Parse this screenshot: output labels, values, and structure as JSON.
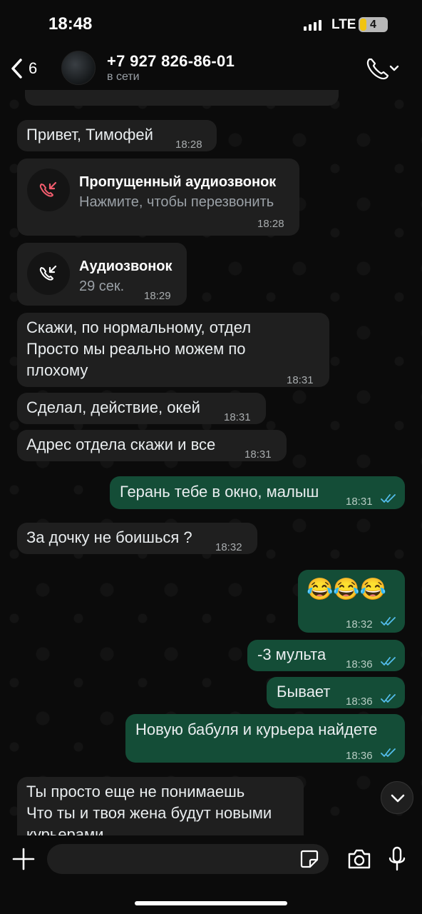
{
  "status_bar": {
    "time": "18:48",
    "network": "LTE",
    "battery": "4"
  },
  "header": {
    "back_count": "6",
    "contact_name": "+7 927 826-86-01",
    "contact_status": "в сети"
  },
  "messages": [
    {
      "text": "Привет, Тимофей",
      "time": "18:28"
    },
    {
      "call_title": "Пропущенный аудиозвонок",
      "call_sub": "Нажмите, чтобы перезвонить",
      "time": "18:28"
    },
    {
      "call_title": "Аудиозвонок",
      "call_sub": "29 сек.",
      "time": "18:29"
    },
    {
      "text": "Скажи, по нормальному, отдел\nПросто мы реально можем по\nплохому",
      "time": "18:31"
    },
    {
      "text": "Сделал, действие, окей",
      "time": "18:31"
    },
    {
      "text": "Адрес отдела скажи и все",
      "time": "18:31"
    },
    {
      "text": "Герань тебе в окно, малыш",
      "time": "18:31"
    },
    {
      "text": "За дочку не боишься ?",
      "time": "18:32"
    },
    {
      "text": "😂😂😂",
      "time": "18:32"
    },
    {
      "text": "-3 мульта",
      "time": "18:36"
    },
    {
      "text": "Бывает",
      "time": "18:36"
    },
    {
      "text": "Новую бабуля и курьера найдете",
      "time": "18:36"
    },
    {
      "text": "Ты просто еще не понимаешь\nЧто ты и твоя жена будут новыми\nкурьерами"
    }
  ],
  "input": {
    "placeholder": ""
  },
  "colors": {
    "incoming": "#1f1f1f",
    "outgoing": "#144d37",
    "read_ticks": "#53bdeb",
    "missed_call": "#f15c6d"
  }
}
